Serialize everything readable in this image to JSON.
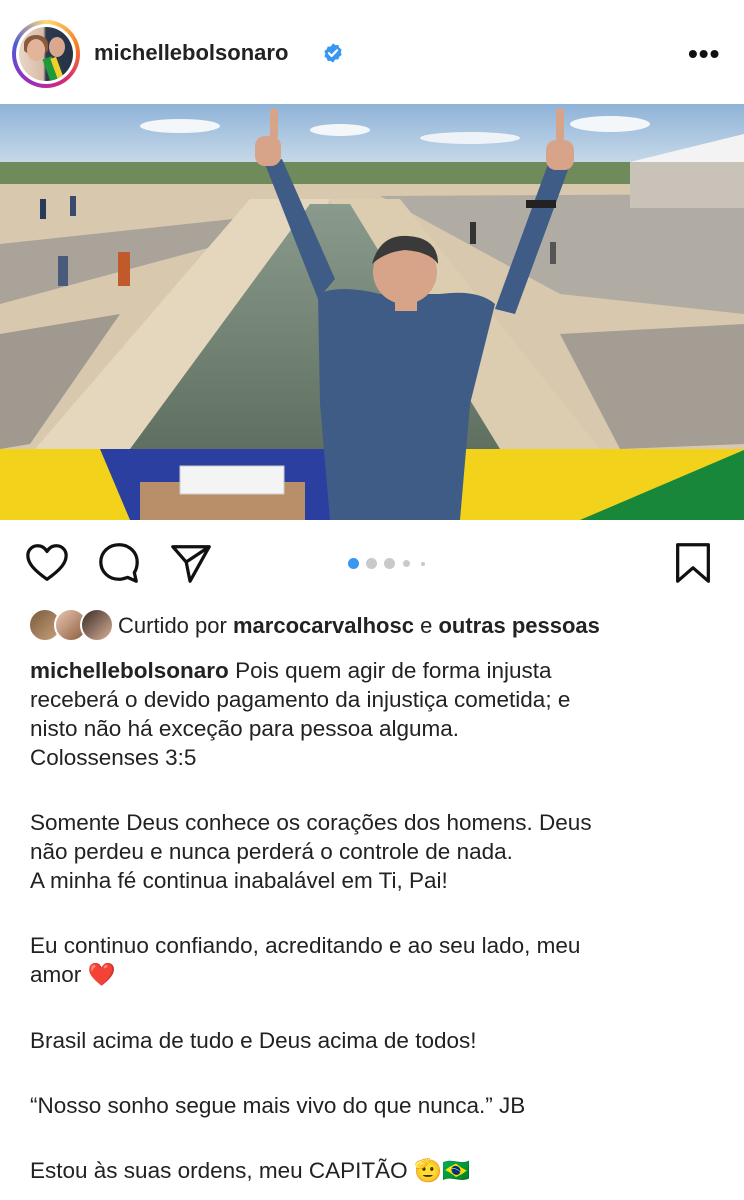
{
  "post": {
    "username": "michellebolsonaro",
    "verified_icon": "verified-badge-icon",
    "more_icon": "more-options-icon",
    "more_label": "•••"
  },
  "actions": {
    "icons": [
      "heart-icon",
      "comment-icon",
      "share-icon",
      "bookmark-icon"
    ],
    "carousel": {
      "count": 5,
      "active": 1
    }
  },
  "likes": {
    "prefix": "Curtido por",
    "user": "marcocarvalhosc",
    "and": "e",
    "others": "outras pessoas"
  },
  "caption": {
    "username": "michellebolsonaro",
    "line1": "Pois quem agir de forma injusta",
    "line2": "receberá o devido pagamento da injustiça cometida; e",
    "line3": "nisto não há exceção para pessoa alguma.",
    "line4": "Colossenses 3:5",
    "line5": "Somente Deus conhece os corações dos homens. Deus",
    "line6": "não perdeu e nunca perderá o controle de nada.",
    "line7": "A minha fé continua inabalável em Ti, Pai!",
    "line8": "Eu continuo confiando, acreditando e ao seu lado, meu",
    "line9": "amor",
    "heart_emoji": "❤️",
    "line10": "Brasil acima de tudo e Deus acima de todos!",
    "line11": "“Nosso sonho segue mais vivo do que nunca.” JB",
    "line12": "Estou às suas ordens, meu CAPITÃO",
    "salute_emoji": "🫡",
    "flag_emoji": "🇧🇷"
  },
  "colors": {
    "verified": "#3897f0",
    "active_dot": "#3897f0",
    "heart": "#e0202a"
  }
}
